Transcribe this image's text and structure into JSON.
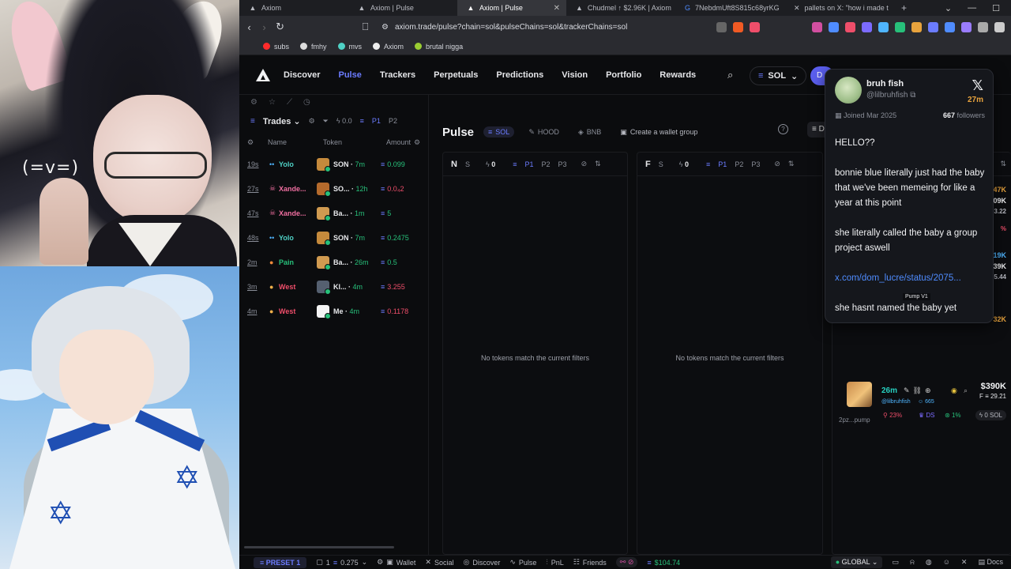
{
  "overlay": {
    "emote": "(=v=)"
  },
  "browser": {
    "tabs": [
      {
        "label": "Axiom",
        "icon": "A",
        "active": false
      },
      {
        "label": "Axiom | Pulse",
        "icon": "A",
        "active": false
      },
      {
        "label": "Axiom | Pulse",
        "icon": "A",
        "active": true
      },
      {
        "label": "Chudmel ↑ $2.96K | Axiom",
        "icon": "A",
        "active": false
      },
      {
        "label": "7NebdmUft8S815c68yrKG",
        "icon": "G",
        "active": false
      },
      {
        "label": "pallets on X: \"how i made t",
        "icon": "X",
        "active": false
      }
    ],
    "url": "axiom.trade/pulse?chain=sol&pulseChains=sol&trackerChains=sol",
    "bookmarks": [
      {
        "label": "subs",
        "color": "#ff2b2b"
      },
      {
        "label": "fmhy",
        "color": "#dddddd"
      },
      {
        "label": "mvs",
        "color": "#4fd1c5"
      },
      {
        "label": "Axiom",
        "color": "#eeeeee"
      },
      {
        "label": "brutal nigga",
        "color": "#9acd32"
      }
    ]
  },
  "nav": {
    "links": [
      "Discover",
      "Pulse",
      "Trackers",
      "Perpetuals",
      "Predictions",
      "Vision",
      "Portfolio",
      "Rewards"
    ],
    "active": "Pulse",
    "chain": "SOL",
    "deposit": "D"
  },
  "trades": {
    "title": "Trades",
    "filter_value": "0.0",
    "p1": "P1",
    "p2": "P2",
    "columns": {
      "name": "Name",
      "token": "Token",
      "amount": "Amount"
    },
    "rows": [
      {
        "age": "19s",
        "emoji": "••",
        "emoji_color": "#4fb5ff",
        "name": "Yolo",
        "name_color": "#4fd1c5",
        "token": "SON",
        "tage": "7m",
        "amount": "0.099",
        "red": false,
        "thumb": "#c58a3c"
      },
      {
        "age": "27s",
        "emoji": "☠",
        "emoji_color": "#ef6fa0",
        "name": "Xande...",
        "name_color": "#ef6fa0",
        "token": "SO...",
        "tage": "12h",
        "amount": "0.0₄2",
        "red": true,
        "thumb": "#b46a2c"
      },
      {
        "age": "47s",
        "emoji": "☠",
        "emoji_color": "#ef6fa0",
        "name": "Xande...",
        "name_color": "#ef6fa0",
        "token": "Ba...",
        "tage": "1m",
        "amount": "5",
        "red": false,
        "thumb": "#d09a50"
      },
      {
        "age": "48s",
        "emoji": "••",
        "emoji_color": "#4fb5ff",
        "name": "Yolo",
        "name_color": "#4fd1c5",
        "token": "SON",
        "tage": "7m",
        "amount": "0.2475",
        "red": false,
        "thumb": "#c58a3c"
      },
      {
        "age": "2m",
        "emoji": "●",
        "emoji_color": "#f08a3a",
        "name": "Pain",
        "name_color": "#27c07a",
        "token": "Ba...",
        "tage": "26m",
        "amount": "0.5",
        "red": false,
        "thumb": "#d09a50"
      },
      {
        "age": "3m",
        "emoji": "●",
        "emoji_color": "#f0b04a",
        "name": "West",
        "name_color": "#ef4e6a",
        "token": "Kl...",
        "tage": "4m",
        "amount": "3.255",
        "red": true,
        "thumb": "#556070"
      },
      {
        "age": "4m",
        "emoji": "●",
        "emoji_color": "#f0b04a",
        "name": "West",
        "name_color": "#ef4e6a",
        "token": "Me",
        "tage": "4m",
        "amount": "0.1178",
        "red": true,
        "thumb": "#f4f4f4"
      }
    ]
  },
  "pulse": {
    "title": "Pulse",
    "chains": [
      "SOL",
      "HOOD",
      "BNB"
    ],
    "active_chain": "SOL",
    "wallet_group": "Create a wallet group",
    "help": "?",
    "columns": [
      {
        "letter": "N",
        "search": "S",
        "filter": "0",
        "p1": "P1",
        "p2": "P2",
        "p3": "P3",
        "empty": "No tokens match the current filters"
      },
      {
        "letter": "F",
        "search": "S",
        "filter": "0",
        "p1": "P1",
        "p2": "P2",
        "p3": "P3",
        "empty": "No tokens match the current filters"
      }
    ],
    "side_values": [
      {
        "text": "47K",
        "color": "#e8a33d"
      },
      {
        "text": "09K",
        "color": "#f1f2f4"
      },
      {
        "text": "3.22",
        "color": "#b8bac2"
      },
      {
        "text": "%",
        "color": "#ef4e6a"
      },
      {
        "text": "19K",
        "color": "#4fb5ff"
      },
      {
        "text": "39K",
        "color": "#f1f2f4"
      },
      {
        "text": "5.44",
        "color": "#b8bac2"
      },
      {
        "text": "32K",
        "color": "#e8a33d"
      }
    ],
    "pump_card": {
      "age": "26m",
      "handle": "@lilbruhfish",
      "followers": "665",
      "addr": "2pz...pump",
      "stat1": "23%",
      "stat2": "DS",
      "stat3": "1%",
      "mc": "$390K",
      "f_value": "29.21",
      "sol": "0 SOL",
      "tooltip": "Pump V1"
    }
  },
  "xcard": {
    "name": "bruh fish",
    "handle": "@lilbruhfish",
    "age": "27m",
    "joined": "Joined Mar 2025",
    "followers_count": "667",
    "followers_label": "followers",
    "paragraphs": [
      "HELLO??",
      "bonnie blue literally just had the baby that we've been memeing for like a year at this point",
      "she literally called the baby a group project aswell"
    ],
    "link": "x.com/dom_lucre/status/2075...",
    "last": "she hasnt named the baby yet"
  },
  "bottom": {
    "preset": "PRESET 1",
    "multiplier": "1",
    "amount": "0.275",
    "items": [
      "Wallet",
      "Social",
      "Discover",
      "Pulse",
      "PnL",
      "Friends"
    ],
    "balance": "$104.74",
    "global": "GLOBAL",
    "docs": "Docs"
  }
}
